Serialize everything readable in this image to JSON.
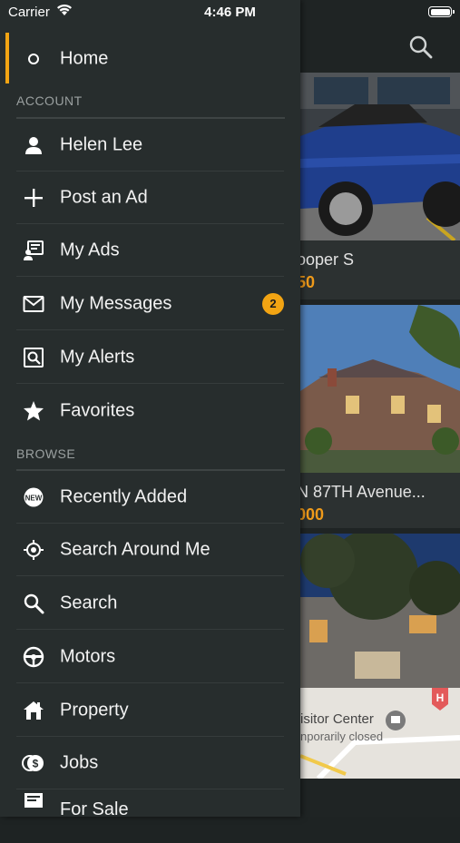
{
  "status_bar": {
    "carrier": "Carrier",
    "time": "4:46 PM"
  },
  "drawer": {
    "home": {
      "label": "Home"
    },
    "account_header": "ACCOUNT",
    "account_items": [
      {
        "label": "Helen Lee",
        "icon": "user-icon"
      },
      {
        "label": "Post an Ad",
        "icon": "plus-icon"
      },
      {
        "label": "My Ads",
        "icon": "ads-icon"
      },
      {
        "label": "My Messages",
        "icon": "mail-icon",
        "badge": "2"
      },
      {
        "label": "My Alerts",
        "icon": "alert-search-icon"
      },
      {
        "label": "Favorites",
        "icon": "star-icon"
      }
    ],
    "browse_header": "BROWSE",
    "browse_items": [
      {
        "label": "Recently Added",
        "icon": "new-tag-icon"
      },
      {
        "label": "Search Around Me",
        "icon": "location-target-icon"
      },
      {
        "label": "Search",
        "icon": "search-icon"
      },
      {
        "label": "Motors",
        "icon": "steering-wheel-icon"
      },
      {
        "label": "Property",
        "icon": "house-icon"
      },
      {
        "label": "Jobs",
        "icon": "coins-icon"
      },
      {
        "label": "For Sale",
        "icon": "for-sale-icon"
      }
    ]
  },
  "listings": [
    {
      "title": "ooper S",
      "price": "50"
    },
    {
      "title": "N 87TH Avenue...",
      "price": "000"
    },
    {
      "map_label": "isitor Center",
      "map_sublabel": "nporarily closed"
    }
  ],
  "colors": {
    "accent": "#f2a413",
    "drawer_bg": "#272d2d",
    "price": "#ef9a1a"
  }
}
